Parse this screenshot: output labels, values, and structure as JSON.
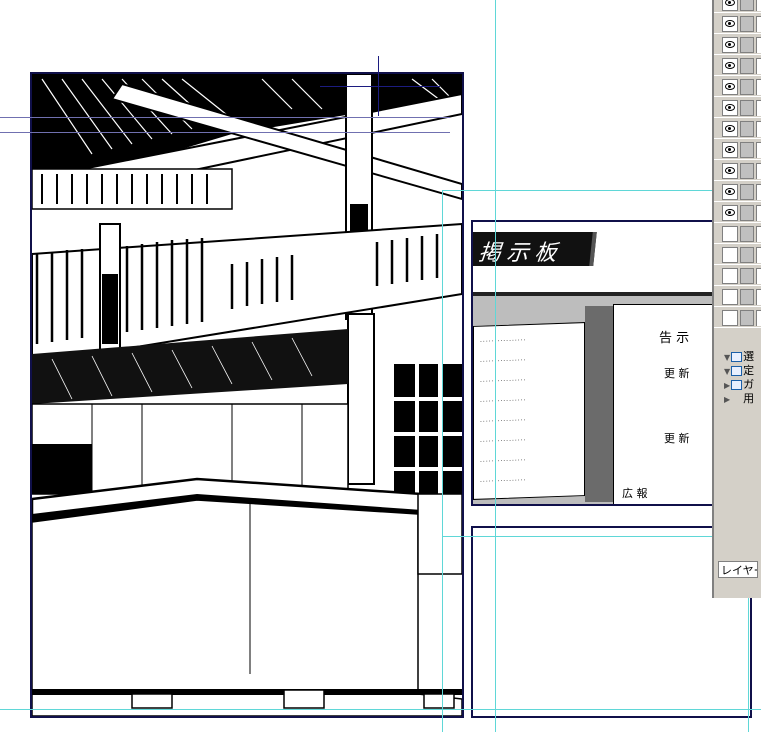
{
  "canvas": {
    "sign": {
      "title": "掲示板",
      "notice_left_lines": [
        "................",
        "................",
        "................",
        "................",
        "................",
        "................",
        "................",
        "................"
      ],
      "notice_right_heading": "告  示",
      "notice_right_line1": "更  新",
      "notice_right_line2": "更  新",
      "notice_right_footer": "広  報"
    }
  },
  "layer_palette": {
    "visible_rows": 11,
    "empty_rows": 5,
    "folders": [
      {
        "label": "選",
        "expanded": true
      },
      {
        "label": "定",
        "expanded": true
      },
      {
        "label": "ガ",
        "expanded": false
      },
      {
        "label": "用",
        "expanded": false
      }
    ],
    "footer_label": "レイヤー"
  },
  "colors": {
    "guide": "#5fd7d7",
    "panel_border": "#10104a",
    "palette_bg": "#d4d0c8"
  }
}
